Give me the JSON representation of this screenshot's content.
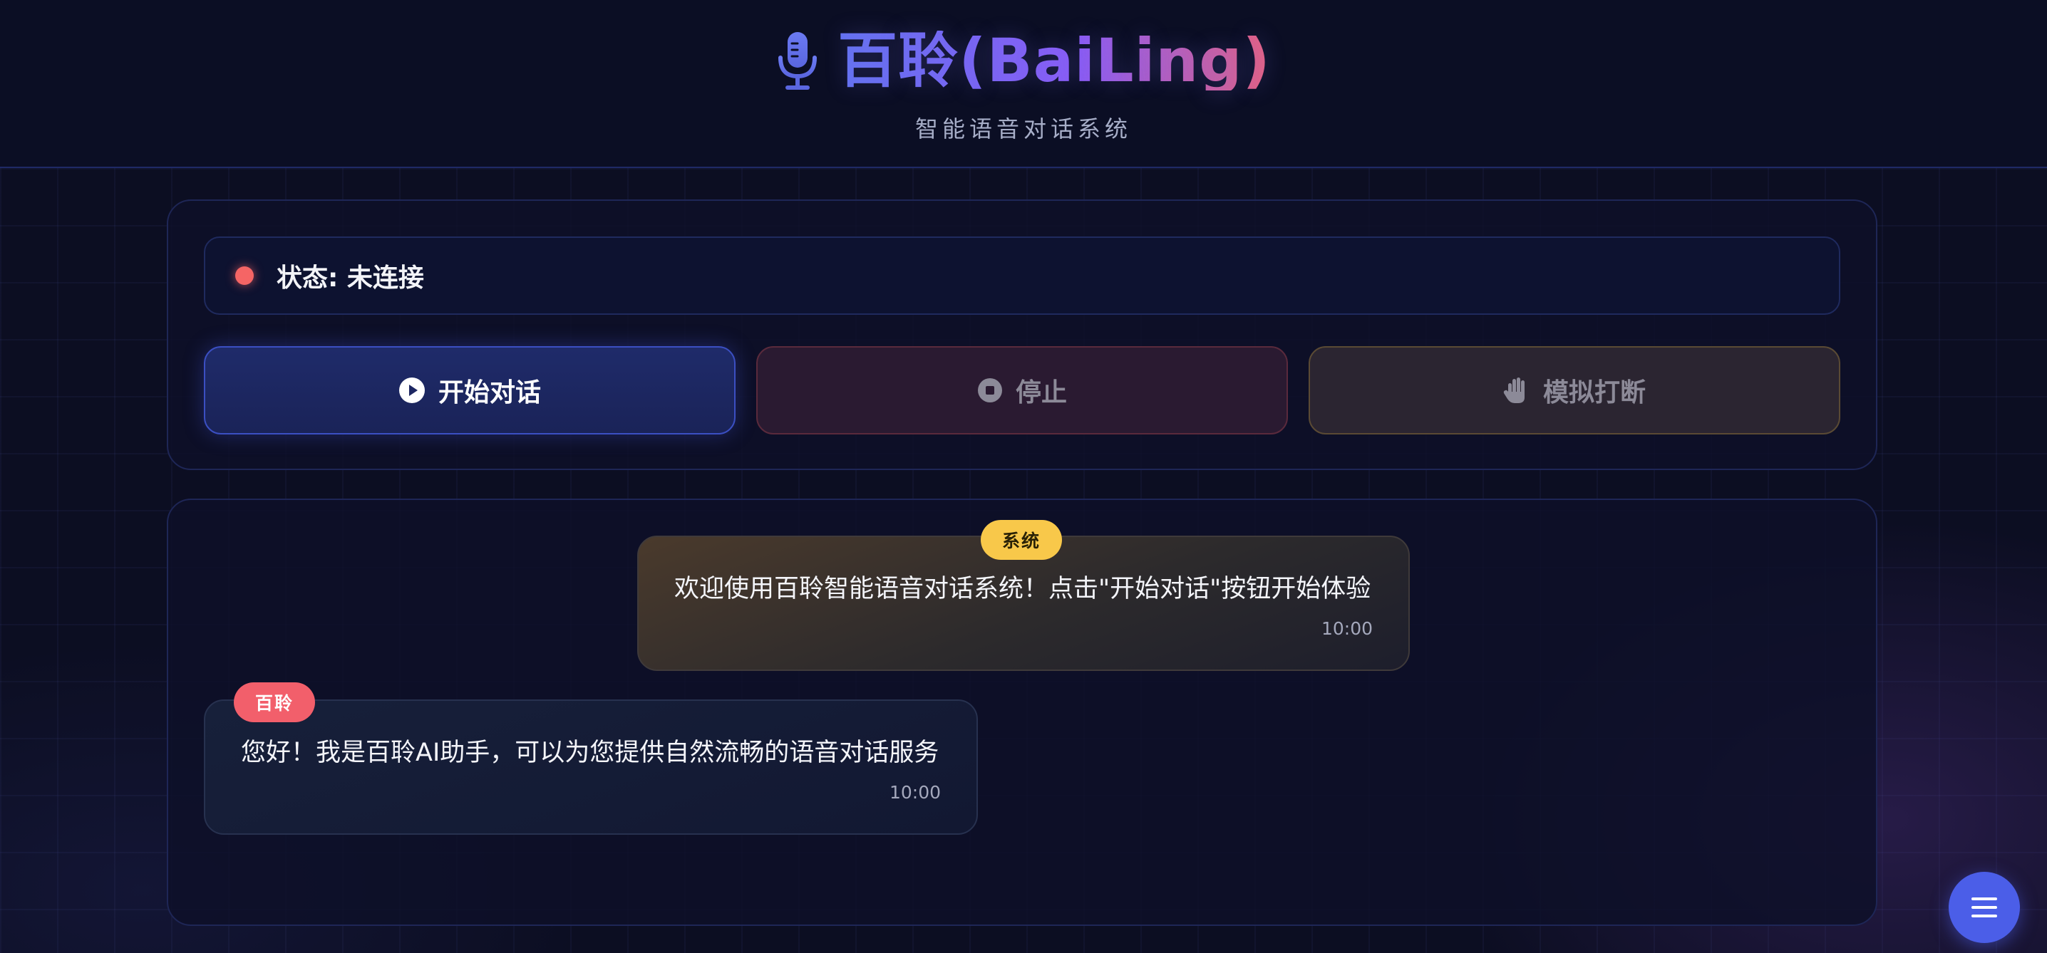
{
  "header": {
    "title": "百聆(BaiLing)",
    "subtitle": "智能语音对话系统",
    "icon": "microphone-icon",
    "title_gradient": [
      "#6373f0",
      "#8b5cf6",
      "#e8617e"
    ]
  },
  "status": {
    "label": "状态: 未连接",
    "dot_color": "#f56565"
  },
  "controls": {
    "start_label": "开始对话",
    "stop_label": "停止",
    "interrupt_label": "模拟打断",
    "start_icon": "play-circle-icon",
    "stop_icon": "stop-circle-icon",
    "interrupt_icon": "hand-icon"
  },
  "messages": [
    {
      "role": "system",
      "badge": "系统",
      "text": "欢迎使用百聆智能语音对话系统！点击\"开始对话\"按钮开始体验",
      "time": "10:00",
      "badge_color": "#f8c84a"
    },
    {
      "role": "assistant",
      "badge": "百聆",
      "text": "您好！我是百聆AI助手，可以为您提供自然流畅的语音对话服务",
      "time": "10:00",
      "badge_color": "#f25f6b"
    }
  ],
  "fab": {
    "icon": "menu-icon",
    "color": "#4b5ee8"
  }
}
